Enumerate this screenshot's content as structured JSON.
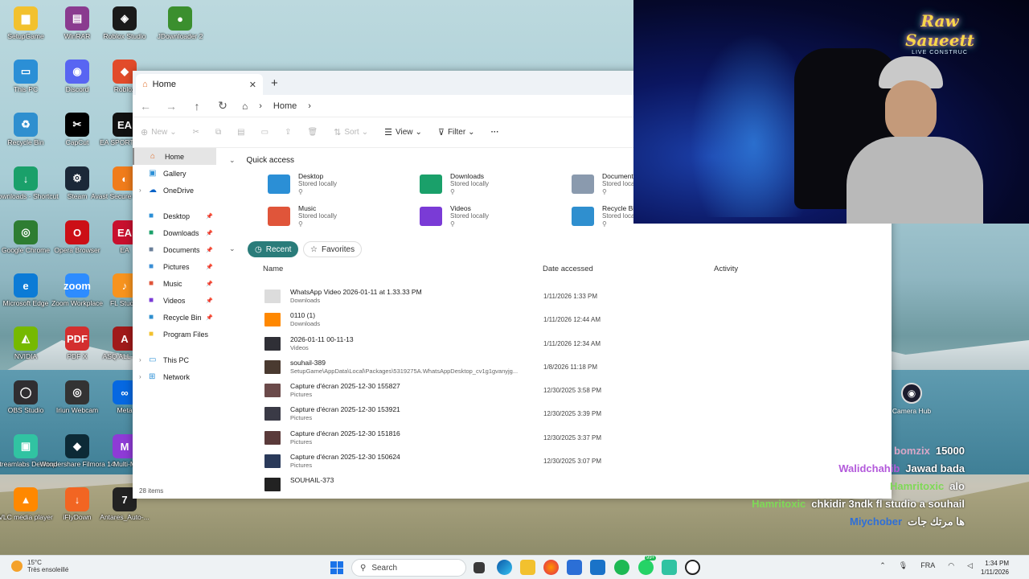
{
  "desktop": {
    "icons": [
      {
        "label": "SetupGame",
        "color": "#f2c12e",
        "glyph": "▆"
      },
      {
        "label": "WinRAR",
        "color": "#8a3b8f",
        "glyph": "▤"
      },
      {
        "label": "Roblox Studio",
        "color": "#1a1a1a",
        "glyph": "◈"
      },
      {
        "label": "JDownloader 2",
        "color": "#3b8f2e",
        "glyph": "●"
      },
      {
        "label": "This PC",
        "color": "#2b8fd6",
        "glyph": "▭"
      },
      {
        "label": "Discord",
        "color": "#5865f2",
        "glyph": "◉"
      },
      {
        "label": "Roblox",
        "color": "#e24b2a",
        "glyph": "◆"
      },
      {
        "label": "Recycle Bin",
        "color": "#2f8fcf",
        "glyph": "♻"
      },
      {
        "label": "CapCut",
        "color": "#000000",
        "glyph": "✂"
      },
      {
        "label": "EA SPORTS FC",
        "color": "#111111",
        "glyph": "EA"
      },
      {
        "label": "Downloads - Shortcut",
        "color": "#1aa06a",
        "glyph": "↓"
      },
      {
        "label": "Steam",
        "color": "#1b2838",
        "glyph": "⚙"
      },
      {
        "label": "Avast Secure Browser",
        "color": "#f07c1b",
        "glyph": "◐"
      },
      {
        "label": "Google Chrome",
        "color": "#2e7d32",
        "glyph": "◎"
      },
      {
        "label": "Opera Browser",
        "color": "#cc0f16",
        "glyph": "O"
      },
      {
        "label": "EA",
        "color": "#c8102e",
        "glyph": "EA"
      },
      {
        "label": "Microsoft Edge",
        "color": "#0c7bd6",
        "glyph": "e"
      },
      {
        "label": "Zoom Workplace",
        "color": "#2d8cff",
        "glyph": "zoom"
      },
      {
        "label": "FL Studio",
        "color": "#f7931e",
        "glyph": "♪"
      },
      {
        "label": "NVIDIA",
        "color": "#76b900",
        "glyph": "◭"
      },
      {
        "label": "PDF X",
        "color": "#d32f2f",
        "glyph": "PDF"
      },
      {
        "label": "ASQ ALL-Sign",
        "color": "#a01a1a",
        "glyph": "A"
      },
      {
        "label": "OBS Studio",
        "color": "#302e31",
        "glyph": "◯"
      },
      {
        "label": "Iriun Webcam",
        "color": "#333333",
        "glyph": "◎"
      },
      {
        "label": "Meta",
        "color": "#0668e1",
        "glyph": "∞"
      },
      {
        "label": "Streamlabs Desktop",
        "color": "#31c3a2",
        "glyph": "▣"
      },
      {
        "label": "Wondershare Filmora 14",
        "color": "#0c2a36",
        "glyph": "◆"
      },
      {
        "label": "Multi-M",
        "color": "#8e3bd6",
        "glyph": "M"
      },
      {
        "label": "VLC media player",
        "color": "#ff8800",
        "glyph": "▲"
      },
      {
        "label": "iFlyDown",
        "color": "#f26522",
        "glyph": "↓"
      },
      {
        "label": "Antares_Auto-...",
        "color": "#222222",
        "glyph": "7"
      }
    ],
    "camera_hub_label": "Camera Hub"
  },
  "explorer": {
    "tab_title": "Home",
    "breadcrumb": "Home",
    "toolbar": {
      "new": "New",
      "sort": "Sort",
      "view": "View",
      "filter": "Filter",
      "more": "···"
    },
    "sidebar": {
      "home": "Home",
      "gallery": "Gallery",
      "onedrive": "OneDrive",
      "pinned": [
        {
          "label": "Desktop",
          "icon": "desktop-icon",
          "color": "#2b8fd6"
        },
        {
          "label": "Downloads",
          "icon": "downloads-icon",
          "color": "#1aa06a"
        },
        {
          "label": "Documents",
          "icon": "documents-icon",
          "color": "#6a7f9a"
        },
        {
          "label": "Pictures",
          "icon": "pictures-icon",
          "color": "#3a8fd6"
        },
        {
          "label": "Music",
          "icon": "music-icon",
          "color": "#e0553a"
        },
        {
          "label": "Videos",
          "icon": "videos-icon",
          "color": "#7a3bd6"
        },
        {
          "label": "Recycle Bin",
          "icon": "recycle-bin-icon",
          "color": "#2f8fcf"
        },
        {
          "label": "Program Files",
          "icon": "folder-icon",
          "color": "#f2c12e"
        }
      ],
      "this_pc": "This PC",
      "network": "Network"
    },
    "quick_access": {
      "title": "Quick access",
      "items": [
        {
          "name": "Desktop",
          "status": "Stored locally",
          "color": "#2b8fd6"
        },
        {
          "name": "Downloads",
          "status": "Stored locally",
          "color": "#1aa06a"
        },
        {
          "name": "Documents",
          "status": "Stored locally",
          "color": "#8a9aae"
        },
        {
          "name": "Music",
          "status": "Stored locally",
          "color": "#e0553a"
        },
        {
          "name": "Videos",
          "status": "Stored locally",
          "color": "#7a3bd6"
        },
        {
          "name": "Recycle Bin",
          "status": "Stored locally",
          "color": "#2f8fcf"
        }
      ]
    },
    "recent_tab": "Recent",
    "favorites_tab": "Favorites",
    "columns": {
      "name": "Name",
      "date": "Date accessed",
      "activity": "Activity"
    },
    "files": [
      {
        "name": "WhatsApp Video 2026-01-11 at 1.33.33 PM",
        "location": "Downloads",
        "date": "1/11/2026 1:33 PM"
      },
      {
        "name": "0110 (1)",
        "location": "Downloads",
        "date": "1/11/2026 12:44 AM"
      },
      {
        "name": "2026-01-11 00-11-13",
        "location": "Videos",
        "date": "1/11/2026 12:34 AM"
      },
      {
        "name": "souhail-389",
        "location": "SetupGame\\AppData\\Local\\Packages\\5319275A.WhatsAppDesktop_cv1g1gvanyjg...",
        "date": "1/8/2026 11:18 PM"
      },
      {
        "name": "Capture d'écran 2025-12-30 155827",
        "location": "Pictures",
        "date": "12/30/2025 3:58 PM"
      },
      {
        "name": "Capture d'écran 2025-12-30 153921",
        "location": "Pictures",
        "date": "12/30/2025 3:39 PM"
      },
      {
        "name": "Capture d'écran 2025-12-30 151816",
        "location": "Pictures",
        "date": "12/30/2025 3:37 PM"
      },
      {
        "name": "Capture d'écran 2025-12-30 150624",
        "location": "Pictures",
        "date": "12/30/2025 3:07 PM"
      },
      {
        "name": "SOUHAIL-373",
        "location": "",
        "date": ""
      }
    ],
    "item_count": "28 items"
  },
  "chat": [
    {
      "user": "bomzix",
      "message": "15000",
      "color": "#d9a7c7"
    },
    {
      "user": "Walidchahib",
      "message": "Jawad bada",
      "color": "#b35adb"
    },
    {
      "user": "Hamritoxic",
      "message": "alo",
      "color": "#7ed957"
    },
    {
      "user": "Hamritoxic",
      "message": "chkidir 3ndk fl studio a souhail",
      "color": "#7ed957"
    },
    {
      "user": "Miychober",
      "message": "ها مرتك جات",
      "color": "#2e6fd8"
    }
  ],
  "taskbar": {
    "weather_temp": "15°C",
    "weather_desc": "Très ensoleillé",
    "search_placeholder": "Search",
    "language": "FRA",
    "time": "1:34 PM",
    "date": "1/11/2026",
    "badge": "99+"
  },
  "stream_overlay": {
    "logo_line1": "Raw Saueett",
    "logo_line2": "LIVE CONSTRUC"
  }
}
